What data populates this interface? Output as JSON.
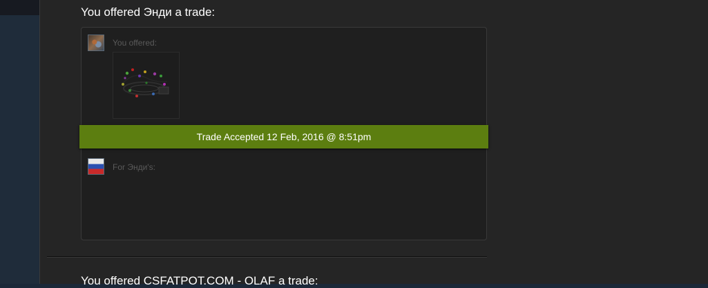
{
  "offers": [
    {
      "heading": "You offered Энди a trade:",
      "you_label": "You offered:",
      "item_icon": "led-garland-item-icon",
      "accepted_text": "Trade Accepted 12 Feb, 2016 @ 8:51pm",
      "them_label": "For Энди's:"
    },
    {
      "heading": "You offered CSFATPOT.COM - OLAF a trade:"
    }
  ],
  "colors": {
    "accepted_bar": "#5c7e10",
    "panel_bg": "#252525",
    "box_bg": "#1f1f1f",
    "page_bg": "#1b2838"
  }
}
